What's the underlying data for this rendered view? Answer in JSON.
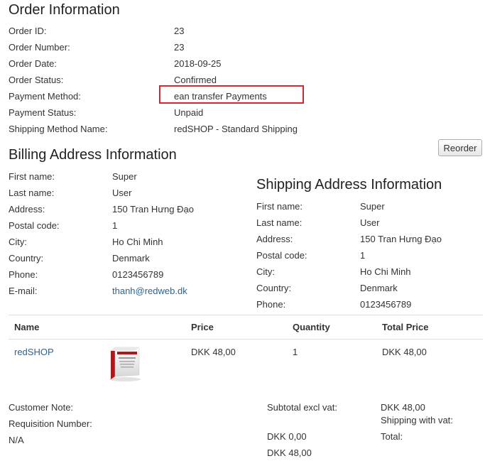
{
  "order_info": {
    "title": "Order Information",
    "rows": [
      {
        "label": "Order ID:",
        "value": "23"
      },
      {
        "label": "Order Number:",
        "value": "23"
      },
      {
        "label": "Order Date:",
        "value": "2018-09-25"
      },
      {
        "label": "Order Status:",
        "value": "Confirmed"
      },
      {
        "label": "Payment Method:",
        "value": "ean transfer Payments"
      },
      {
        "label": "Payment Status:",
        "value": "Unpaid"
      },
      {
        "label": "Shipping Method Name:",
        "value": "redSHOP - Standard Shipping"
      }
    ]
  },
  "reorder_label": "Reorder",
  "billing": {
    "title": "Billing Address Information",
    "rows": [
      {
        "label": "First name:",
        "value": "Super"
      },
      {
        "label": "Last name:",
        "value": "User"
      },
      {
        "label": "Address:",
        "value": "150 Tran Hưng Đạo"
      },
      {
        "label": "Postal code:",
        "value": "1"
      },
      {
        "label": "City:",
        "value": "Ho Chi Minh"
      },
      {
        "label": "Country:",
        "value": "Denmark"
      },
      {
        "label": "Phone:",
        "value": "0123456789"
      },
      {
        "label": "E-mail:",
        "value": "thanh@redweb.dk"
      }
    ]
  },
  "shipping": {
    "title": "Shipping Address Information",
    "rows": [
      {
        "label": "First name:",
        "value": "Super"
      },
      {
        "label": "Last name:",
        "value": "User"
      },
      {
        "label": "Address:",
        "value": "150 Tran Hưng Đạo"
      },
      {
        "label": "Postal code:",
        "value": "1"
      },
      {
        "label": "City:",
        "value": "Ho Chi Minh"
      },
      {
        "label": "Country:",
        "value": "Denmark"
      },
      {
        "label": "Phone:",
        "value": "0123456789"
      }
    ]
  },
  "items_table": {
    "headers": [
      "Name",
      "Price",
      "Quantity",
      "Total Price"
    ],
    "rows": [
      {
        "name": "redSHOP",
        "price": "DKK 48,00",
        "quantity": "1",
        "total": "DKK 48,00"
      }
    ]
  },
  "footer": {
    "customer_note_label": "Customer Note:",
    "requisition_label": "Requisition Number:",
    "requisition_value": "N/A",
    "subtotal_label": "Subtotal excl vat:",
    "subtotal_value": "DKK 48,00",
    "shipping_label": "Shipping with vat:",
    "shipping_value": "DKK 0,00",
    "total_label": "Total:",
    "total_value": "DKK 48,00"
  },
  "colors": {
    "link": "#2a6496",
    "highlight": "#d9232e",
    "divider": "#dddddd"
  }
}
